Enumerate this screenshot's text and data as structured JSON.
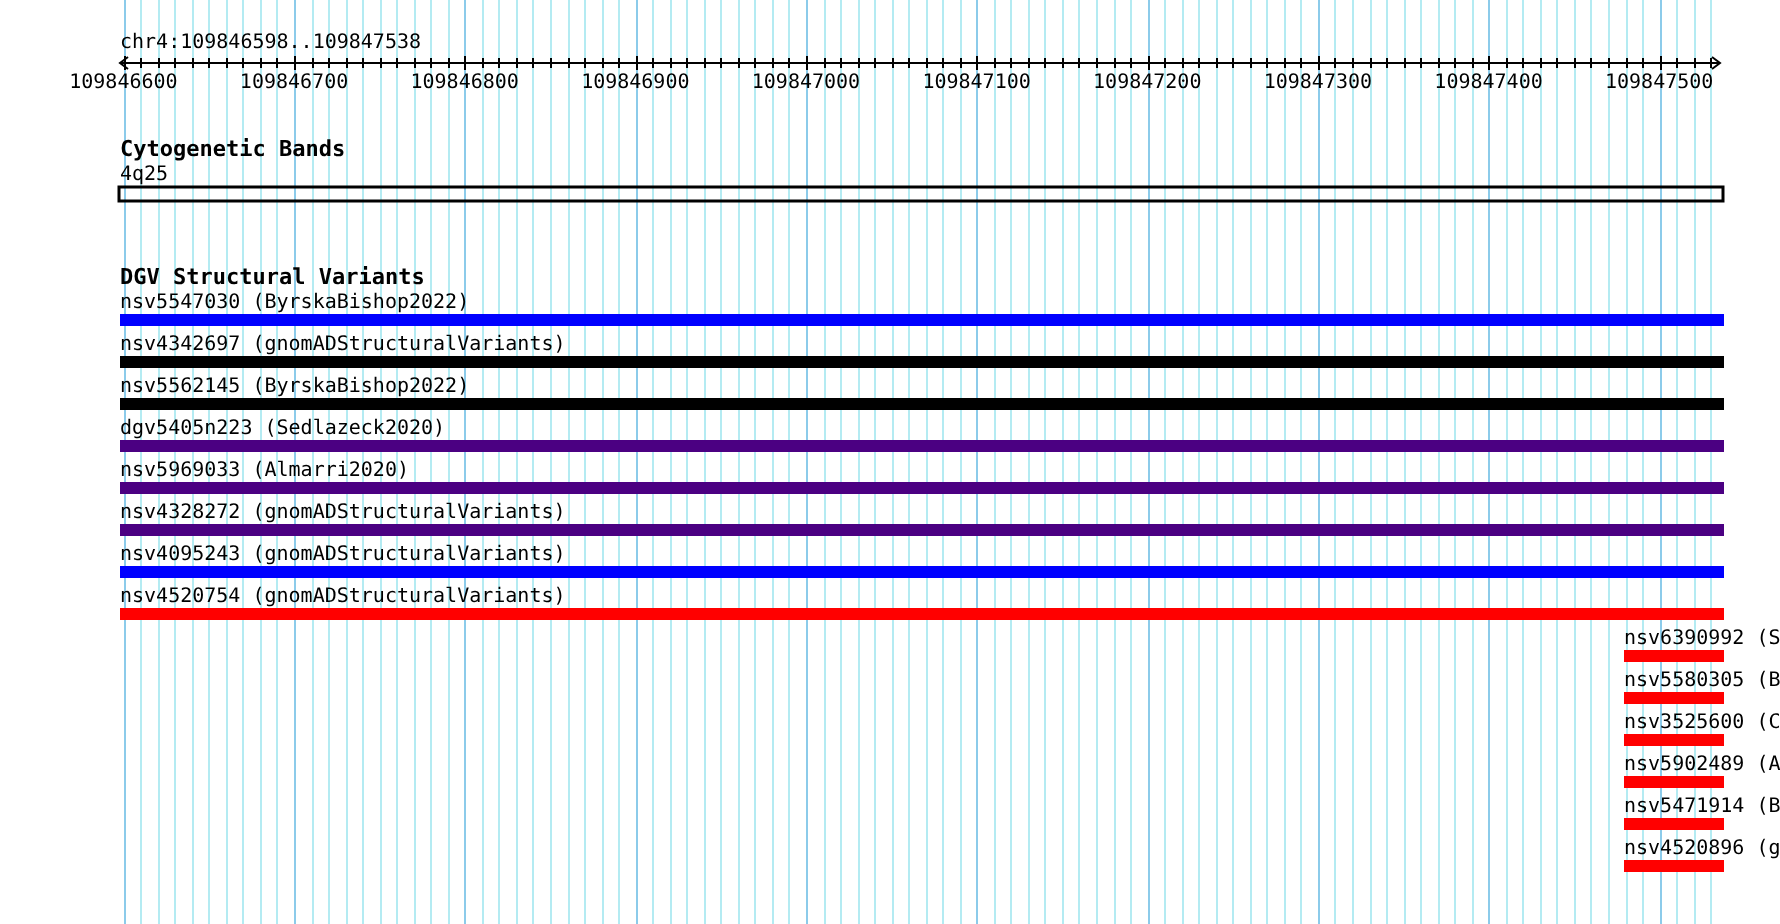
{
  "ruler": {
    "label": "chr4:109846598..109847538",
    "ticks": [
      "109846600",
      "109846700",
      "109846800",
      "109846900",
      "109847000",
      "109847100",
      "109847200",
      "109847300",
      "109847400",
      "109847500"
    ]
  },
  "tracks": [
    {
      "title": "Cytogenetic Bands",
      "features": [
        {
          "label": "4q25",
          "kind": "band"
        }
      ]
    },
    {
      "title": "DGV Structural Variants",
      "features": [
        {
          "label": "nsv5547030 (ByrskaBishop2022)",
          "kind": "full",
          "color": "#0000ff"
        },
        {
          "label": "nsv4342697 (gnomADStructuralVariants)",
          "kind": "full",
          "color": "#000000"
        },
        {
          "label": "nsv5562145 (ByrskaBishop2022)",
          "kind": "full",
          "color": "#000000"
        },
        {
          "label": "dgv5405n223 (Sedlazeck2020)",
          "kind": "full",
          "color": "#4b0082"
        },
        {
          "label": "nsv5969033 (Almarri2020)",
          "kind": "full",
          "color": "#4b0082"
        },
        {
          "label": "nsv4328272 (gnomADStructuralVariants)",
          "kind": "full",
          "color": "#4b0082"
        },
        {
          "label": "nsv4095243 (gnomADStructuralVariants)",
          "kind": "full",
          "color": "#0000ff"
        },
        {
          "label": "nsv4520754 (gnomADStructuralVariants)",
          "kind": "full",
          "color": "#ff0000"
        },
        {
          "label": "nsv6390992 (S",
          "kind": "end",
          "color": "#ff0000"
        },
        {
          "label": "nsv5580305 (B",
          "kind": "end",
          "color": "#ff0000"
        },
        {
          "label": "nsv3525600 (C",
          "kind": "end",
          "color": "#ff0000"
        },
        {
          "label": "nsv5902489 (A",
          "kind": "end",
          "color": "#ff0000"
        },
        {
          "label": "nsv5471914 (B",
          "kind": "end",
          "color": "#ff0000"
        },
        {
          "label": "nsv4520896 (g",
          "kind": "end",
          "color": "#ff0000"
        }
      ]
    }
  ]
}
